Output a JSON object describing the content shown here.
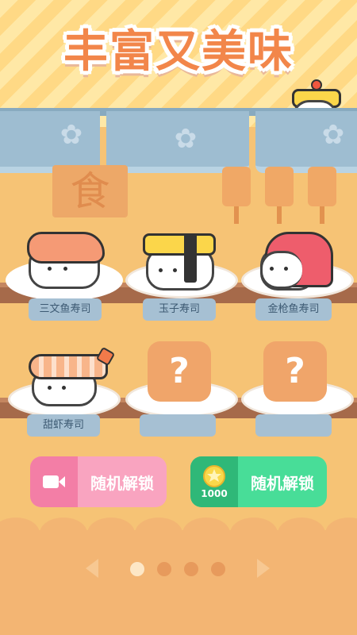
{
  "header": {
    "title": "丰富又美味"
  },
  "sign": {
    "char": "食"
  },
  "items": [
    {
      "label": "三文鱼寿司",
      "state": "unlocked"
    },
    {
      "label": "玉子寿司",
      "state": "unlocked"
    },
    {
      "label": "金枪鱼寿司",
      "state": "unlocked"
    },
    {
      "label": "甜虾寿司",
      "state": "unlocked"
    },
    {
      "label": "",
      "state": "locked",
      "mark": "?"
    },
    {
      "label": "",
      "state": "locked",
      "mark": "?"
    }
  ],
  "buttons": {
    "video_unlock": {
      "label": "随机解锁",
      "icon": "video-camera-icon",
      "color": "#f37ea6"
    },
    "coin_unlock": {
      "label": "随机解锁",
      "cost": "1000",
      "icon": "coin-star-icon",
      "color": "#3fd18c"
    }
  },
  "pagination": {
    "pages": 4,
    "current": 1
  }
}
